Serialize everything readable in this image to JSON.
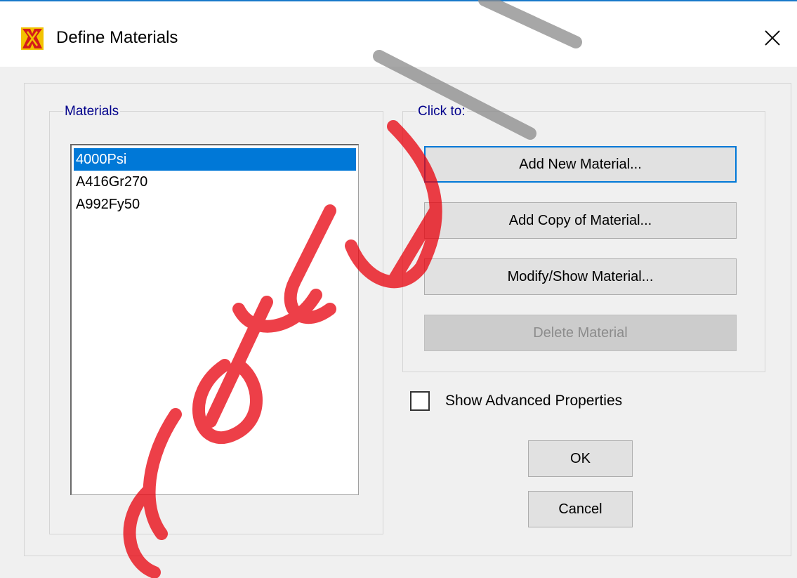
{
  "window": {
    "title": "Define Materials",
    "close_glyph": "✕"
  },
  "materials_group": {
    "label": "Materials",
    "items": [
      "4000Psi",
      "A416Gr270",
      "A992Fy50"
    ],
    "selected_index": 0
  },
  "actions_group": {
    "label": "Click to:",
    "add_new_label": "Add New Material...",
    "add_copy_label": "Add Copy of Material...",
    "modify_show_label": "Modify/Show Material...",
    "delete_label": "Delete Material",
    "delete_enabled": false
  },
  "advanced": {
    "label": "Show Advanced Properties",
    "checked": false
  },
  "footer": {
    "ok_label": "OK",
    "cancel_label": "Cancel"
  },
  "colors": {
    "selection": "#0078d7",
    "group_label": "#00008b",
    "title_accent": "#1979ca",
    "watermark_red": "#e8000b",
    "watermark_gray": "#8a8a8a"
  },
  "icons": {
    "app": "sap-app-icon",
    "close": "close-icon"
  }
}
